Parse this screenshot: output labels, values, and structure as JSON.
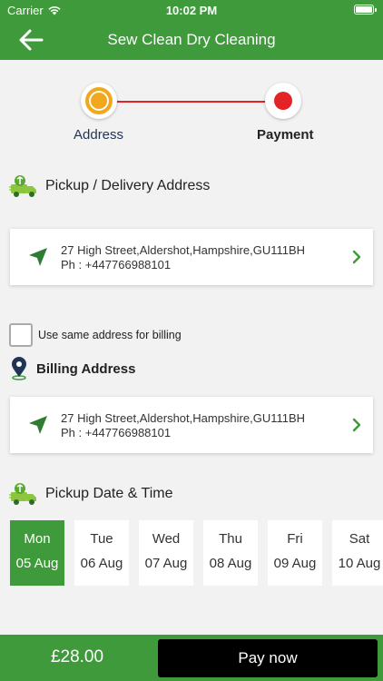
{
  "status_bar": {
    "carrier": "Carrier",
    "time": "10:02 PM"
  },
  "nav": {
    "title": "Sew Clean Dry Cleaning"
  },
  "stepper": {
    "steps": [
      {
        "label": "Address"
      },
      {
        "label": "Payment"
      }
    ]
  },
  "pickup_section": {
    "heading": "Pickup / Delivery Address",
    "address_line": "27 High Street,Aldershot,Hampshire,GU111BH",
    "phone_line": "Ph : +447766988101"
  },
  "billing_toggle": {
    "label": "Use same address for billing",
    "checked": false
  },
  "billing_section": {
    "heading": "Billing Address",
    "address_line": "27 High Street,Aldershot,Hampshire,GU111BH",
    "phone_line": "Ph : +447766988101"
  },
  "datetime_section": {
    "heading": "Pickup Date & Time",
    "dates": [
      {
        "day": "Mon",
        "date": "05 Aug",
        "selected": true
      },
      {
        "day": "Tue",
        "date": "06 Aug",
        "selected": false
      },
      {
        "day": "Wed",
        "date": "07 Aug",
        "selected": false
      },
      {
        "day": "Thu",
        "date": "08 Aug",
        "selected": false
      },
      {
        "day": "Fri",
        "date": "09 Aug",
        "selected": false
      },
      {
        "day": "Sat",
        "date": "10 Aug",
        "selected": false
      }
    ]
  },
  "footer": {
    "price": "£28.00",
    "pay_label": "Pay now"
  },
  "colors": {
    "brand_green": "#3e9a3a",
    "step_active": "#f2a81d",
    "step_pending": "#e42326"
  }
}
